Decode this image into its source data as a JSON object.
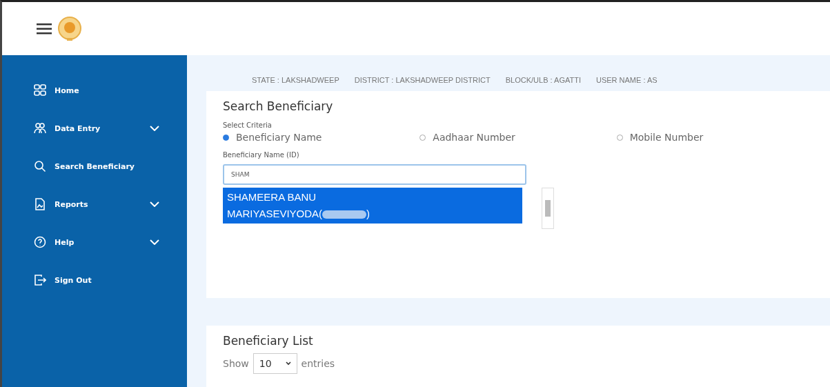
{
  "sidebar": {
    "items": [
      {
        "label": "Home",
        "kind": "home",
        "expandable": false
      },
      {
        "label": "Data Entry",
        "kind": "users",
        "expandable": true
      },
      {
        "label": "Search Beneficiary",
        "kind": "search",
        "expandable": false
      },
      {
        "label": "Reports",
        "kind": "report",
        "expandable": true
      },
      {
        "label": "Help",
        "kind": "help",
        "expandable": true
      },
      {
        "label": "Sign Out",
        "kind": "signout",
        "expandable": false
      }
    ]
  },
  "info_bar": [
    "STATE : LAKSHADWEEP",
    "DISTRICT : LAKSHADWEEP DISTRICT",
    "BLOCK/ULB : AGATTI",
    "USER NAME : AS"
  ],
  "search_card": {
    "title": "Search Beneficiary",
    "criteria_label": "Select Criteria",
    "criteria": [
      {
        "label": "Beneficiary Name",
        "selected": true
      },
      {
        "label": "Aadhaar Number",
        "selected": false
      },
      {
        "label": "Mobile Number",
        "selected": false
      }
    ],
    "field_label": "Beneficiary Name (ID)",
    "value": "SHAM",
    "suggestions": [
      {
        "text_before": "SHAMEERA BANU MARIYASEVIYODA(",
        "text_after": ")",
        "selected": true
      }
    ]
  },
  "list_card": {
    "title": "Beneficiary List",
    "show_label": "Show",
    "page_size": "10",
    "entries_label": "entries"
  }
}
